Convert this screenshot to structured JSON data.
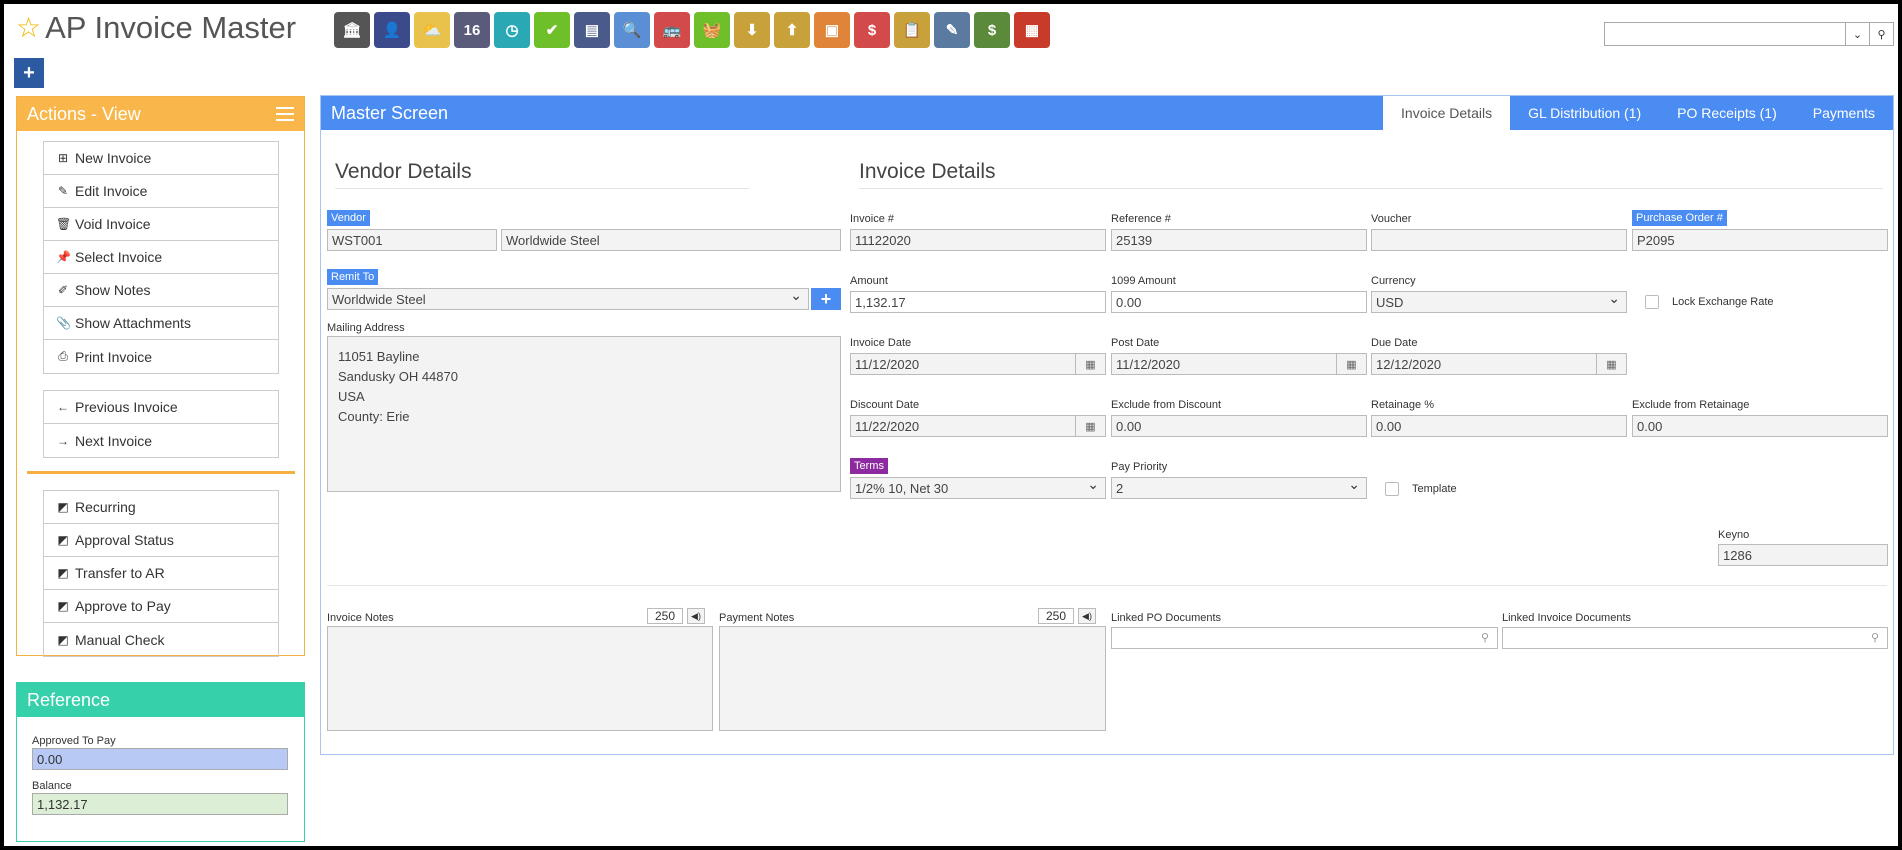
{
  "app": {
    "title": "AP Invoice Master"
  },
  "toolbar": {
    "icons": [
      {
        "name": "bank-icon",
        "glyph": "🏛",
        "color": "#555555"
      },
      {
        "name": "user-icon",
        "glyph": "👤",
        "color": "#3a4a8a"
      },
      {
        "name": "weather-icon",
        "glyph": "⛅",
        "color": "#e8c24a"
      },
      {
        "name": "calendar-icon",
        "glyph": "16",
        "color": "#5a5a7a"
      },
      {
        "name": "clock-icon",
        "glyph": "◷",
        "color": "#2aa9b5"
      },
      {
        "name": "checkmark-icon",
        "glyph": "✔",
        "color": "#6fbf2a"
      },
      {
        "name": "register-icon",
        "glyph": "▤",
        "color": "#4a5a8a"
      },
      {
        "name": "magnifier-icon",
        "glyph": "🔍",
        "color": "#5a8fd6"
      },
      {
        "name": "bus-icon",
        "glyph": "🚌",
        "color": "#d34a4a"
      },
      {
        "name": "basket-icon",
        "glyph": "🧺",
        "color": "#6fbf2a"
      },
      {
        "name": "download-box-icon",
        "glyph": "⬇",
        "color": "#c9a13a"
      },
      {
        "name": "upload-box-icon",
        "glyph": "⬆",
        "color": "#c9a13a"
      },
      {
        "name": "cash-register-icon",
        "glyph": "▣",
        "color": "#e0843a"
      },
      {
        "name": "speech-bubble-icon",
        "glyph": "$",
        "color": "#d34a4a"
      },
      {
        "name": "clipboard-icon",
        "glyph": "📋",
        "color": "#c9a13a"
      },
      {
        "name": "pencil-icon",
        "glyph": "✎",
        "color": "#5a7aa0"
      },
      {
        "name": "money-icon",
        "glyph": "$",
        "color": "#5a8a3a"
      },
      {
        "name": "factory-icon",
        "glyph": "▦",
        "color": "#c83a2a"
      }
    ]
  },
  "search": {
    "placeholder": "",
    "value": ""
  },
  "actions": {
    "title": "Actions - View",
    "group1": [
      {
        "label": "New Invoice",
        "icon": "⊞"
      },
      {
        "label": "Edit Invoice",
        "icon": "✎"
      },
      {
        "label": "Void Invoice",
        "icon": "🗑"
      },
      {
        "label": "Select Invoice",
        "icon": "📌"
      },
      {
        "label": "Show Notes",
        "icon": "✐"
      },
      {
        "label": "Show Attachments",
        "icon": "📎"
      },
      {
        "label": "Print Invoice",
        "icon": "⎙"
      }
    ],
    "group2": [
      {
        "label": "Previous Invoice",
        "icon": "←"
      },
      {
        "label": "Next Invoice",
        "icon": "→"
      }
    ],
    "group3": [
      {
        "label": "Recurring",
        "icon": "◩"
      },
      {
        "label": "Approval Status",
        "icon": "◩"
      },
      {
        "label": "Transfer to AR",
        "icon": "◩"
      },
      {
        "label": "Approve to Pay",
        "icon": "◩"
      },
      {
        "label": "Manual Check",
        "icon": "◩"
      }
    ]
  },
  "reference": {
    "title": "Reference",
    "approved_label": "Approved To Pay",
    "approved_value": "0.00",
    "balance_label": "Balance",
    "balance_value": "1,132.17"
  },
  "master": {
    "title": "Master Screen",
    "tabs": [
      "Invoice Details",
      "GL Distribution (1)",
      "PO Receipts (1)",
      "Payments"
    ]
  },
  "vendor": {
    "section_title": "Vendor Details",
    "vendor_tag": "Vendor",
    "vendor_code": "WST001",
    "vendor_name": "Worldwide Steel",
    "remit_tag": "Remit To",
    "remit_value": "Worldwide Steel",
    "mailing_label": "Mailing Address",
    "address": [
      "11051 Bayline",
      "Sandusky OH  44870",
      "USA",
      "County: Erie"
    ]
  },
  "invoice": {
    "section_title": "Invoice Details",
    "invoice_no_label": "Invoice #",
    "invoice_no": "11122020",
    "reference_label": "Reference #",
    "reference": "25139",
    "voucher_label": "Voucher",
    "voucher": "",
    "po_tag": "Purchase Order #",
    "po": "P2095",
    "amount_label": "Amount",
    "amount": "1,132.17",
    "amount1099_label": "1099 Amount",
    "amount1099": "0.00",
    "currency_label": "Currency",
    "currency": "USD",
    "lock_label": "Lock Exchange Rate",
    "invoice_date_label": "Invoice Date",
    "invoice_date": "11/12/2020",
    "post_date_label": "Post Date",
    "post_date": "11/12/2020",
    "due_date_label": "Due Date",
    "due_date": "12/12/2020",
    "discount_date_label": "Discount Date",
    "discount_date": "11/22/2020",
    "excl_discount_label": "Exclude from Discount",
    "excl_discount": "0.00",
    "retainage_label": "Retainage %",
    "retainage": "0.00",
    "excl_retainage_label": "Exclude from Retainage",
    "excl_retainage": "0.00",
    "terms_tag": "Terms",
    "terms": "1/2% 10, Net 30",
    "priority_label": "Pay Priority",
    "priority": "2",
    "template_label": "Template",
    "keyno_label": "Keyno",
    "keyno": "1286"
  },
  "notes": {
    "invoice_notes_label": "Invoice Notes",
    "invoice_notes_count": "250",
    "payment_notes_label": "Payment Notes",
    "payment_notes_count": "250",
    "linked_po_label": "Linked PO Documents",
    "linked_invoice_label": "Linked Invoice Documents"
  },
  "colors": {
    "actions_accent": "#f9b64a",
    "reference_accent": "#36d1ab",
    "master_accent": "#4a8cf2",
    "terms_tag": "#8e2aa0"
  }
}
